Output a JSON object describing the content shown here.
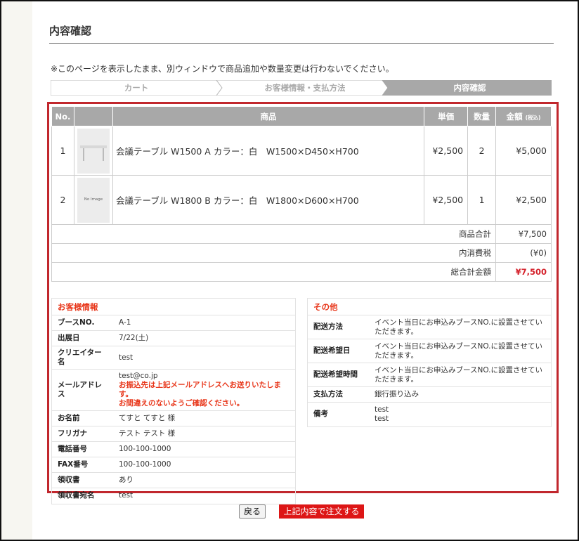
{
  "page": {
    "title": "内容確認",
    "notice": "※このページを表示したまま、別ウィンドウで商品追加や数量変更は行わないでください。"
  },
  "steps": [
    "カート",
    "お客様情報・支払方法",
    "内容確認"
  ],
  "items_table": {
    "headers": {
      "no": "No.",
      "product": "商品",
      "unit": "単価",
      "qty": "数量",
      "amount": "金額",
      "amount_suffix": "(税込)"
    },
    "rows": [
      {
        "no": "1",
        "name": "会議テーブル W1500 A カラー：白　W1500×D450×H700",
        "unit": "¥2,500",
        "qty": "2",
        "amount": "¥5,000"
      },
      {
        "no": "2",
        "name": "会議テーブル W1800 B カラー：白　W1800×D600×H700",
        "unit": "¥2,500",
        "qty": "1",
        "amount": "¥2,500",
        "no_image_label": "No Image"
      }
    ],
    "summary": [
      {
        "label": "商品合計",
        "value": "¥7,500"
      },
      {
        "label": "内消費税",
        "value": "(¥0)"
      },
      {
        "label": "総合計金額",
        "value": "¥7,500"
      }
    ]
  },
  "customer": {
    "heading": "お客様情報",
    "fields": [
      {
        "label": "ブースNO.",
        "value": "A-1"
      },
      {
        "label": "出展日",
        "value": "7/22(土)"
      },
      {
        "label": "クリエイター名",
        "value": "test"
      },
      {
        "label": "メールアドレス",
        "value": "test@co.jp",
        "note1": "お振込先は上記メールアドレスへお送りいたします。",
        "note2": "お間違えのないようご確認ください。"
      },
      {
        "label": "お名前",
        "value": "てすと てすと 様"
      },
      {
        "label": "フリガナ",
        "value": "テスト テスト 様"
      },
      {
        "label": "電話番号",
        "value": "100-100-1000"
      },
      {
        "label": "FAX番号",
        "value": "100-100-1000"
      },
      {
        "label": "領収書",
        "value": "あり"
      },
      {
        "label": "領収書宛名",
        "value": "test"
      }
    ]
  },
  "other": {
    "heading": "その他",
    "fields": [
      {
        "label": "配送方法",
        "value": "イベント当日にお申込みブースNO.に設置させていただきます。"
      },
      {
        "label": "配送希望日",
        "value": "イベント当日にお申込みブースNO.に設置させていただきます。"
      },
      {
        "label": "配送希望時間",
        "value": "イベント当日にお申込みブースNO.に設置させていただきます。"
      },
      {
        "label": "支払方法",
        "value": "銀行振り込み"
      },
      {
        "label": "備考",
        "value1": "test",
        "value2": "test"
      }
    ]
  },
  "buttons": {
    "back": "戻る",
    "order": "上記内容で注文する"
  },
  "colors": {
    "accent_red": "#dd1616",
    "heading_red": "#e8371b",
    "header_gray": "#a8a8a8"
  }
}
